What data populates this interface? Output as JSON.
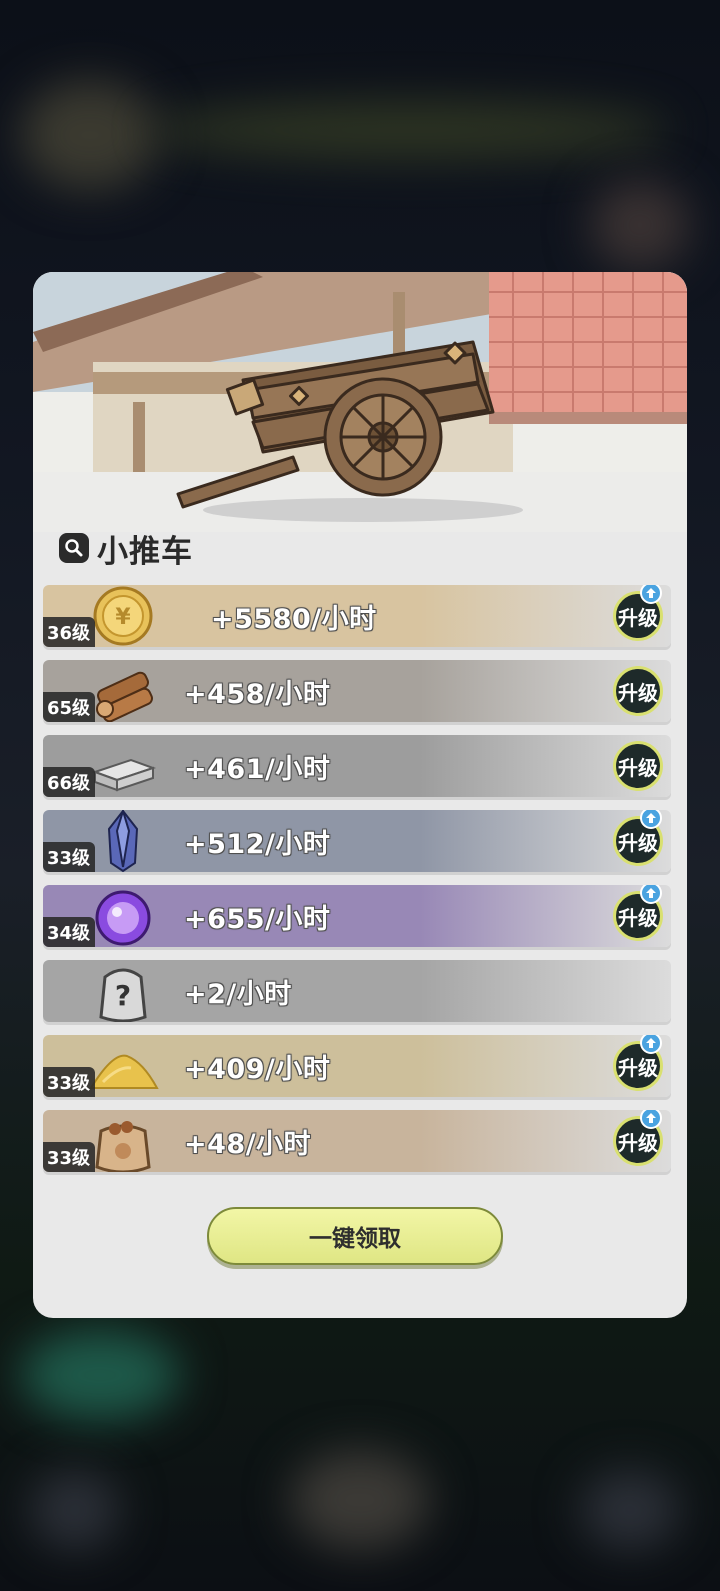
{
  "header": {
    "title": "小推车"
  },
  "resources": [
    {
      "name": "gold-coin",
      "level": "36级",
      "rate": "+5580/小时",
      "upgrade_label": "升级",
      "upgrade_available": true,
      "bg": "#d8c4a0"
    },
    {
      "name": "wood",
      "level": "65级",
      "rate": "+458/小时",
      "upgrade_label": "升级",
      "upgrade_available": false,
      "bg": "#a7a29c"
    },
    {
      "name": "iron",
      "level": "66级",
      "rate": "+461/小时",
      "upgrade_label": "升级",
      "upgrade_available": false,
      "bg": "#9d9d9d"
    },
    {
      "name": "crystal",
      "level": "33级",
      "rate": "+512/小时",
      "upgrade_label": "升级",
      "upgrade_available": true,
      "bg": "#8f96a6"
    },
    {
      "name": "purple-orb",
      "level": "34级",
      "rate": "+655/小时",
      "upgrade_label": "升级",
      "upgrade_available": true,
      "bg": "#9888b6"
    },
    {
      "name": "unknown-bag",
      "level": "",
      "rate": "+2/小时",
      "upgrade_label": "",
      "upgrade_available": false,
      "bg": "#a5a5a5"
    },
    {
      "name": "sand",
      "level": "33级",
      "rate": "+409/小时",
      "upgrade_label": "升级",
      "upgrade_available": true,
      "bg": "#cdbf9b"
    },
    {
      "name": "food-bag",
      "level": "33级",
      "rate": "+48/小时",
      "upgrade_label": "升级",
      "upgrade_available": true,
      "bg": "#c8b49c"
    }
  ],
  "collect": {
    "label": "一键领取"
  }
}
